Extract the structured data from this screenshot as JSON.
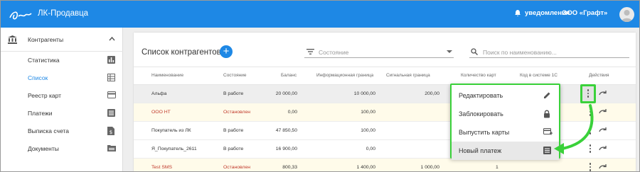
{
  "app": {
    "title": "ЛК-Продавца"
  },
  "header": {
    "notifications_label": "уведомления",
    "org_name": "ООО «Графт»"
  },
  "sidebar": {
    "group": {
      "label": "Контрагенты",
      "expanded": true
    },
    "items": [
      {
        "label": "Статистика",
        "icon": "bar-chart-icon",
        "active": false
      },
      {
        "label": "Список",
        "icon": "list-grid-icon",
        "active": true
      },
      {
        "label": "Реестр карт",
        "icon": "credit-card-icon",
        "active": false
      },
      {
        "label": "Платежи",
        "icon": "payments-icon",
        "active": false
      },
      {
        "label": "Выписка счета",
        "icon": "invoice-icon",
        "active": false
      },
      {
        "label": "Документы",
        "icon": "folder-icon",
        "active": false
      }
    ]
  },
  "main": {
    "title": "Список контрагентов",
    "filter_placeholder": "Состояние",
    "search_placeholder": "Поиск по наименованию...",
    "columns": [
      "Наименование",
      "Состояние",
      "Баланс",
      "Информационная граница",
      "Сигнальная граница",
      "Количество карт",
      "Код в системе 1С",
      "Действия"
    ],
    "rows": [
      {
        "name": "Альфа",
        "status": "В работе",
        "balance": "20 000,00",
        "info_limit": "10 000,00",
        "signal_limit": "200,00",
        "cards": "",
        "code": "",
        "blocked": false,
        "hover": true
      },
      {
        "name": "ООО НТ",
        "status": "Остановлен",
        "balance": "0,00",
        "info_limit": "100,00",
        "signal_limit": "",
        "cards": "",
        "code": "",
        "blocked": true,
        "hover": false
      },
      {
        "name": "Покупатель из ЛК",
        "status": "В работе",
        "balance": "47 850,50",
        "info_limit": "100,00",
        "signal_limit": "",
        "cards": "",
        "code": "",
        "blocked": false,
        "hover": false
      },
      {
        "name": "Я_Покупатель_2611",
        "status": "В работе",
        "balance": "16 900,00",
        "info_limit": "0,00",
        "signal_limit": "",
        "cards": "",
        "code": "",
        "blocked": false,
        "hover": false
      },
      {
        "name": "Test SMS",
        "status": "Остановлен",
        "balance": "800,33",
        "info_limit": "1 400,00",
        "signal_limit": "1 000,00",
        "cards": "1",
        "code": "",
        "blocked": true,
        "hover": false
      }
    ],
    "action_menu": [
      {
        "label": "Редактировать",
        "icon": "pencil-icon"
      },
      {
        "label": "Заблокировать",
        "icon": "lock-icon"
      },
      {
        "label": "Выпустить карты",
        "icon": "card-add-icon"
      },
      {
        "label": "Новый платеж",
        "icon": "payment-list-icon",
        "highlighted": true
      }
    ]
  },
  "colors": {
    "primary": "#1e88e5",
    "highlight": "#3ad13a",
    "blocked_text": "#c0392b",
    "blocked_row": "#fffbea"
  }
}
